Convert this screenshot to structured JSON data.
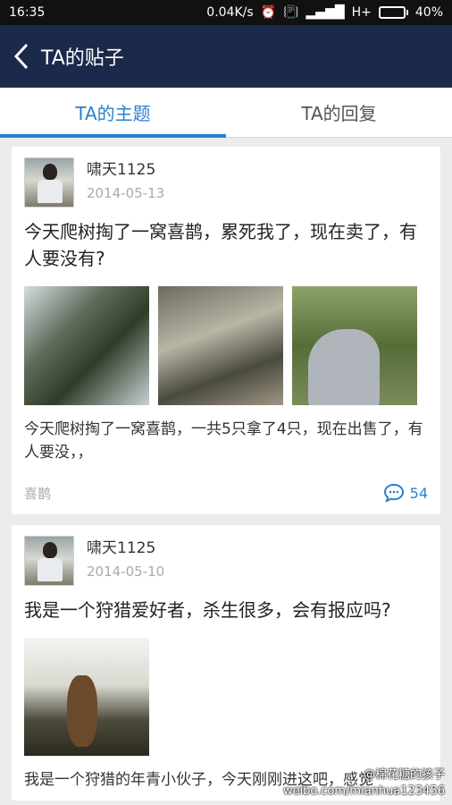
{
  "status_bar": {
    "time": "16:35",
    "speed": "0.04K/s",
    "network": "H+",
    "battery": "40%",
    "battery_level": 0.4
  },
  "nav": {
    "title": "TA的贴子",
    "back_icon": "chevron-left-icon"
  },
  "tabs": [
    {
      "label": "TA的主题",
      "active": true
    },
    {
      "label": "TA的回复",
      "active": false
    }
  ],
  "posts": [
    {
      "author": "啸天1125",
      "date": "2014-05-13",
      "title": "今天爬树掏了一窝喜鹊，累死我了，现在卖了，有人要没有?",
      "body": "今天爬树掏了一窝喜鹊，一共5只拿了4只，现在出售了，有人要没，，",
      "tag": "喜鹊",
      "comment_count": "54"
    },
    {
      "author": "啸天1125",
      "date": "2014-05-10",
      "title": "我是一个狩猎爱好者，杀生很多，会有报应吗?",
      "body": "我是一个狩猎的年青小伙子，今天刚刚进这吧，感觉"
    }
  ],
  "watermark": {
    "line1": "@棉花糖的孩子",
    "line2": "weibo.com/mianhua123456"
  },
  "colors": {
    "accent": "#2a7fd0",
    "nav_bg": "#1b2a4a"
  }
}
